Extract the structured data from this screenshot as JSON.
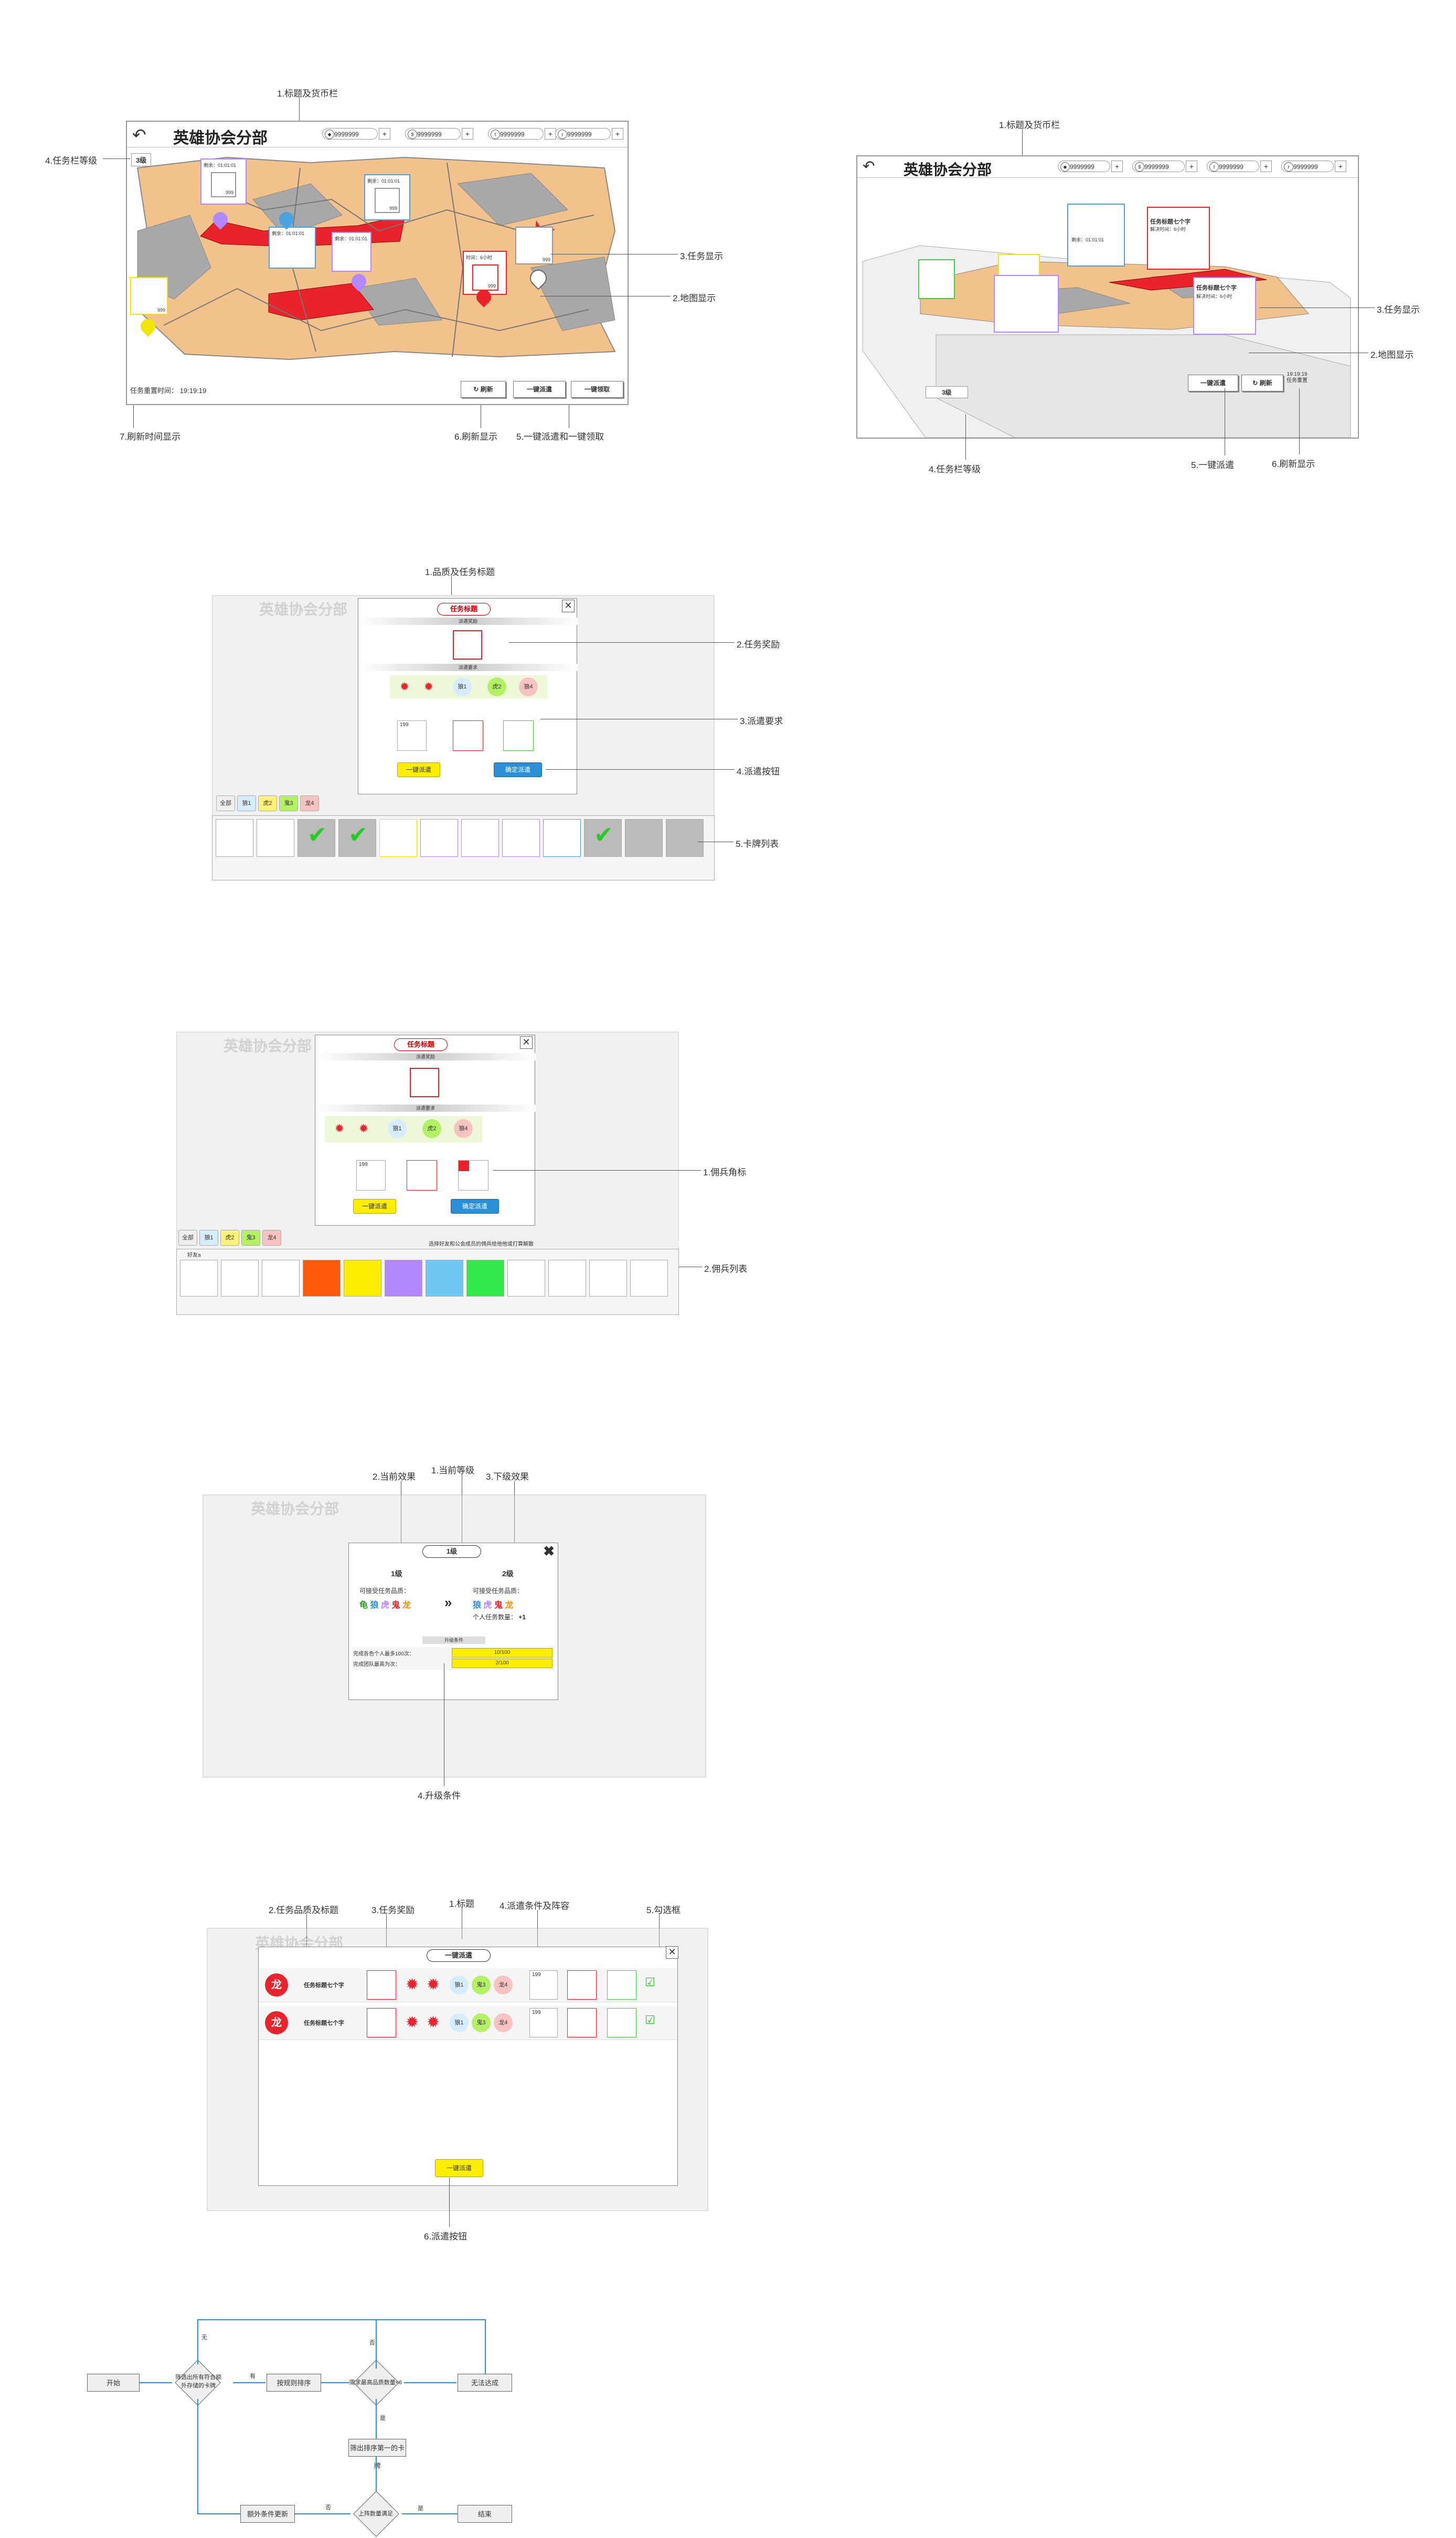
{
  "panel1": {
    "title": "英雄协会分部",
    "currencies": [
      "9999999",
      "9999999",
      "9999999",
      "9999999"
    ],
    "currency_icons": [
      "gem-icon",
      "coin-icon",
      "token-icon",
      "ticket-icon"
    ],
    "level": "3级",
    "refresh_time_label": "任务重置时间：",
    "refresh_time": "19:19:19",
    "btn_refresh": "刷新",
    "btn_dispatch_all": "一键派遣",
    "btn_claim_all": "一键领取",
    "timer_a": "剩余：01:01:01",
    "timer_b": "剩余：01:01:01",
    "timer_c": "剩余：01:01:01",
    "timer_d": "剩余：01:01:01",
    "timer_e": "时间：6小时",
    "card_value": "999",
    "notes": {
      "n1": "1.标题及货币栏",
      "n2": "2.地图显示",
      "n3": "3.任务显示",
      "n4": "4.任务栏等级",
      "n5": "5.一键派遣和一键领取",
      "n6": "6.刷新显示",
      "n7": "7.刷新时间显示"
    }
  },
  "panel2": {
    "title": "英雄协会分部",
    "currencies": [
      "9999999",
      "9999999",
      "9999999",
      "9999999"
    ],
    "level": "3级",
    "task_title": "任务标题七个字",
    "solve_time": "解决时间：6小时",
    "timer": "剩余：01:01:01",
    "btn_dispatch_all": "一键派遣",
    "btn_refresh": "刷新",
    "refresh_time": "19:19:19",
    "refresh_label": "任务重置",
    "notes": {
      "n1": "1.标题及货币栏",
      "n2": "2.地图显示",
      "n3": "3.任务显示",
      "n4": "4.任务栏等级",
      "n5": "5.一键派遣",
      "n6": "6.刷新显示"
    }
  },
  "panel3": {
    "modal_title": "任务标题",
    "reward_band": "派遣奖励",
    "require_band": "派遣要求",
    "req_items": [
      "",
      "",
      "狼1",
      "虎2",
      "狼4"
    ],
    "btn_auto": "一键派遣",
    "btn_confirm": "确定派遣",
    "tabs": [
      "全部",
      "狼1",
      "虎2",
      "鬼3",
      "龙4"
    ],
    "card_num": "199",
    "notes": {
      "n1": "1.品质及任务标题",
      "n2": "2.任务奖励",
      "n3": "3.派遣要求",
      "n4": "4.派遣按钮",
      "n5": "5.卡牌列表"
    }
  },
  "panel4": {
    "modal_title": "任务标题",
    "reward_band": "派遣奖励",
    "require_band": "派遣要求",
    "btn_auto": "一键派遣",
    "btn_confirm": "确定派遣",
    "tabs": [
      "全部",
      "狼1",
      "虎2",
      "鬼3",
      "龙4"
    ],
    "hint": "选择好友和公会成员的佣兵给他他或打算解散",
    "friend_label": "好友a",
    "card_num": "199",
    "notes": {
      "n1": "1.佣兵角标",
      "n2": "2.佣兵列表"
    }
  },
  "panel5": {
    "title": "英雄协会分部",
    "modal_level": "1级",
    "cur_level": "1级",
    "next_level": "2级",
    "accept_label": "可接受任务品质：",
    "accept_label2": "可接受任务品质：",
    "grades_cur": [
      "龟",
      "狼",
      "虎",
      "鬼",
      "龙"
    ],
    "grades_next": [
      "狼",
      "虎",
      "鬼",
      "龙"
    ],
    "personal_tasks": "个人任务数量：",
    "personal_tasks_val": "+1",
    "upgrade_band": "升级条件",
    "cond1": "完成各色个人最多100次：",
    "cond1_val": "10/100",
    "cond2": "完成团队最高为次：",
    "cond2_val": "2/100",
    "notes": {
      "n1": "1.当前等级",
      "n2": "2.当前效果",
      "n3": "3.下级效果",
      "n4": "4.升级条件"
    }
  },
  "panel6": {
    "title": "英雄协会分部",
    "modal_title": "一键派遣",
    "rows": [
      {
        "grade": "龙",
        "title": "任务标题七个字",
        "reqs": [
          "狼1",
          "鬼3",
          "龙4"
        ],
        "num": "199"
      },
      {
        "grade": "龙",
        "title": "任务标题七个字",
        "reqs": [
          "狼1",
          "鬼3",
          "龙4"
        ],
        "num": "199"
      }
    ],
    "btn_dispatch": "一键派遣",
    "notes": {
      "n1": "1.标题",
      "n2": "2.任务品质及标题",
      "n3": "3.任务奖励",
      "n4": "4.派遣条件及阵容",
      "n5": "5.勾选框",
      "n6": "6.派遣按钮"
    }
  },
  "flow": {
    "start": "开始",
    "check": "筛选出所有符合额外存储的卡牌",
    "yes": "有",
    "no": "无",
    "sort": "按规则排序",
    "need": "需求最高品质数量<6",
    "yes2": "是",
    "no2": "否",
    "pick": "筛出排序第一的卡牌",
    "can_not": "无法达成",
    "enough": "上阵数量满足",
    "extra": "额外条件更新",
    "end": "结束",
    "yes3": "是",
    "no3": "否"
  }
}
